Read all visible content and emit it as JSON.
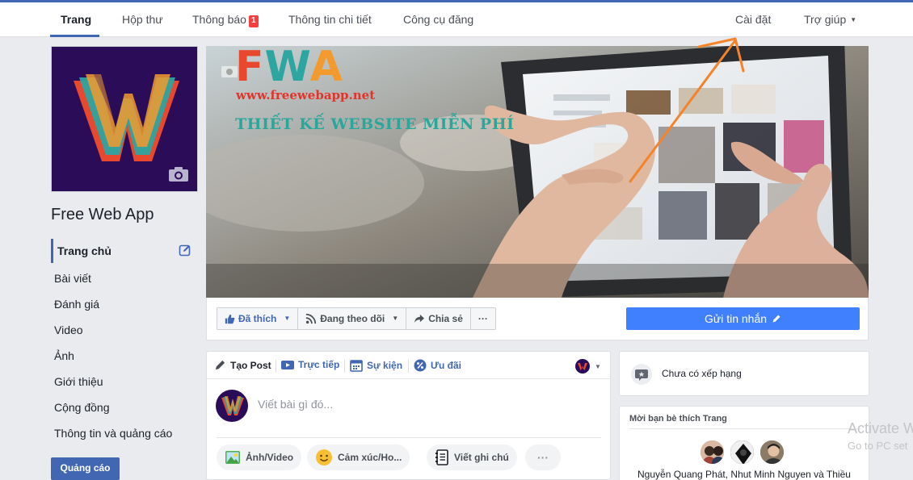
{
  "tabs": {
    "home": "Trang",
    "inbox": "Hộp thư",
    "notifications": "Thông báo",
    "notifications_count": "1",
    "insights": "Thông tin chi tiết",
    "publishing_tools": "Công cụ đăng",
    "settings": "Cài đặt",
    "help": "Trợ giúp"
  },
  "page": {
    "name": "Free Web App"
  },
  "sidebar": {
    "items": [
      {
        "label": "Trang chủ"
      },
      {
        "label": "Bài viết"
      },
      {
        "label": "Đánh giá"
      },
      {
        "label": "Video"
      },
      {
        "label": "Ảnh"
      },
      {
        "label": "Giới thiệu"
      },
      {
        "label": "Cộng đồng"
      },
      {
        "label": "Thông tin và quảng cáo"
      }
    ],
    "ads_button": "Quảng cáo"
  },
  "cover": {
    "logo_f": "F",
    "logo_w": "W",
    "logo_a": "A",
    "url": "www.freewebapp.net",
    "slogan": "THIẾT KẾ WEBSITE MIỄN PHÍ"
  },
  "actions": {
    "liked": "Đã thích",
    "following": "Đang theo dõi",
    "share": "Chia sẻ",
    "more": "···",
    "send_message": "Gửi tin nhắn"
  },
  "composer": {
    "tabs": [
      "Tạo Post",
      "Trực tiếp",
      "Sự kiện",
      "Ưu đãi"
    ],
    "placeholder": "Viết bài gì đó...",
    "pills": [
      "Ảnh/Video",
      "Cảm xúc/Ho...",
      "Viết ghi chú"
    ],
    "more": "···"
  },
  "rating": {
    "text": "Chưa có xếp hạng"
  },
  "invite": {
    "title": "Mời bạn bè thích Trang",
    "names": "Nguyễn Quang Phát, Nhut Minh Nguyen và Thiều"
  },
  "watermark": {
    "title": "Activate W",
    "subtitle": "Go to PC set"
  },
  "colors": {
    "accent": "#4267b2",
    "send_button": "#4080ff",
    "badge": "#fa3e3e",
    "annotation_arrow": "#f5832a"
  }
}
